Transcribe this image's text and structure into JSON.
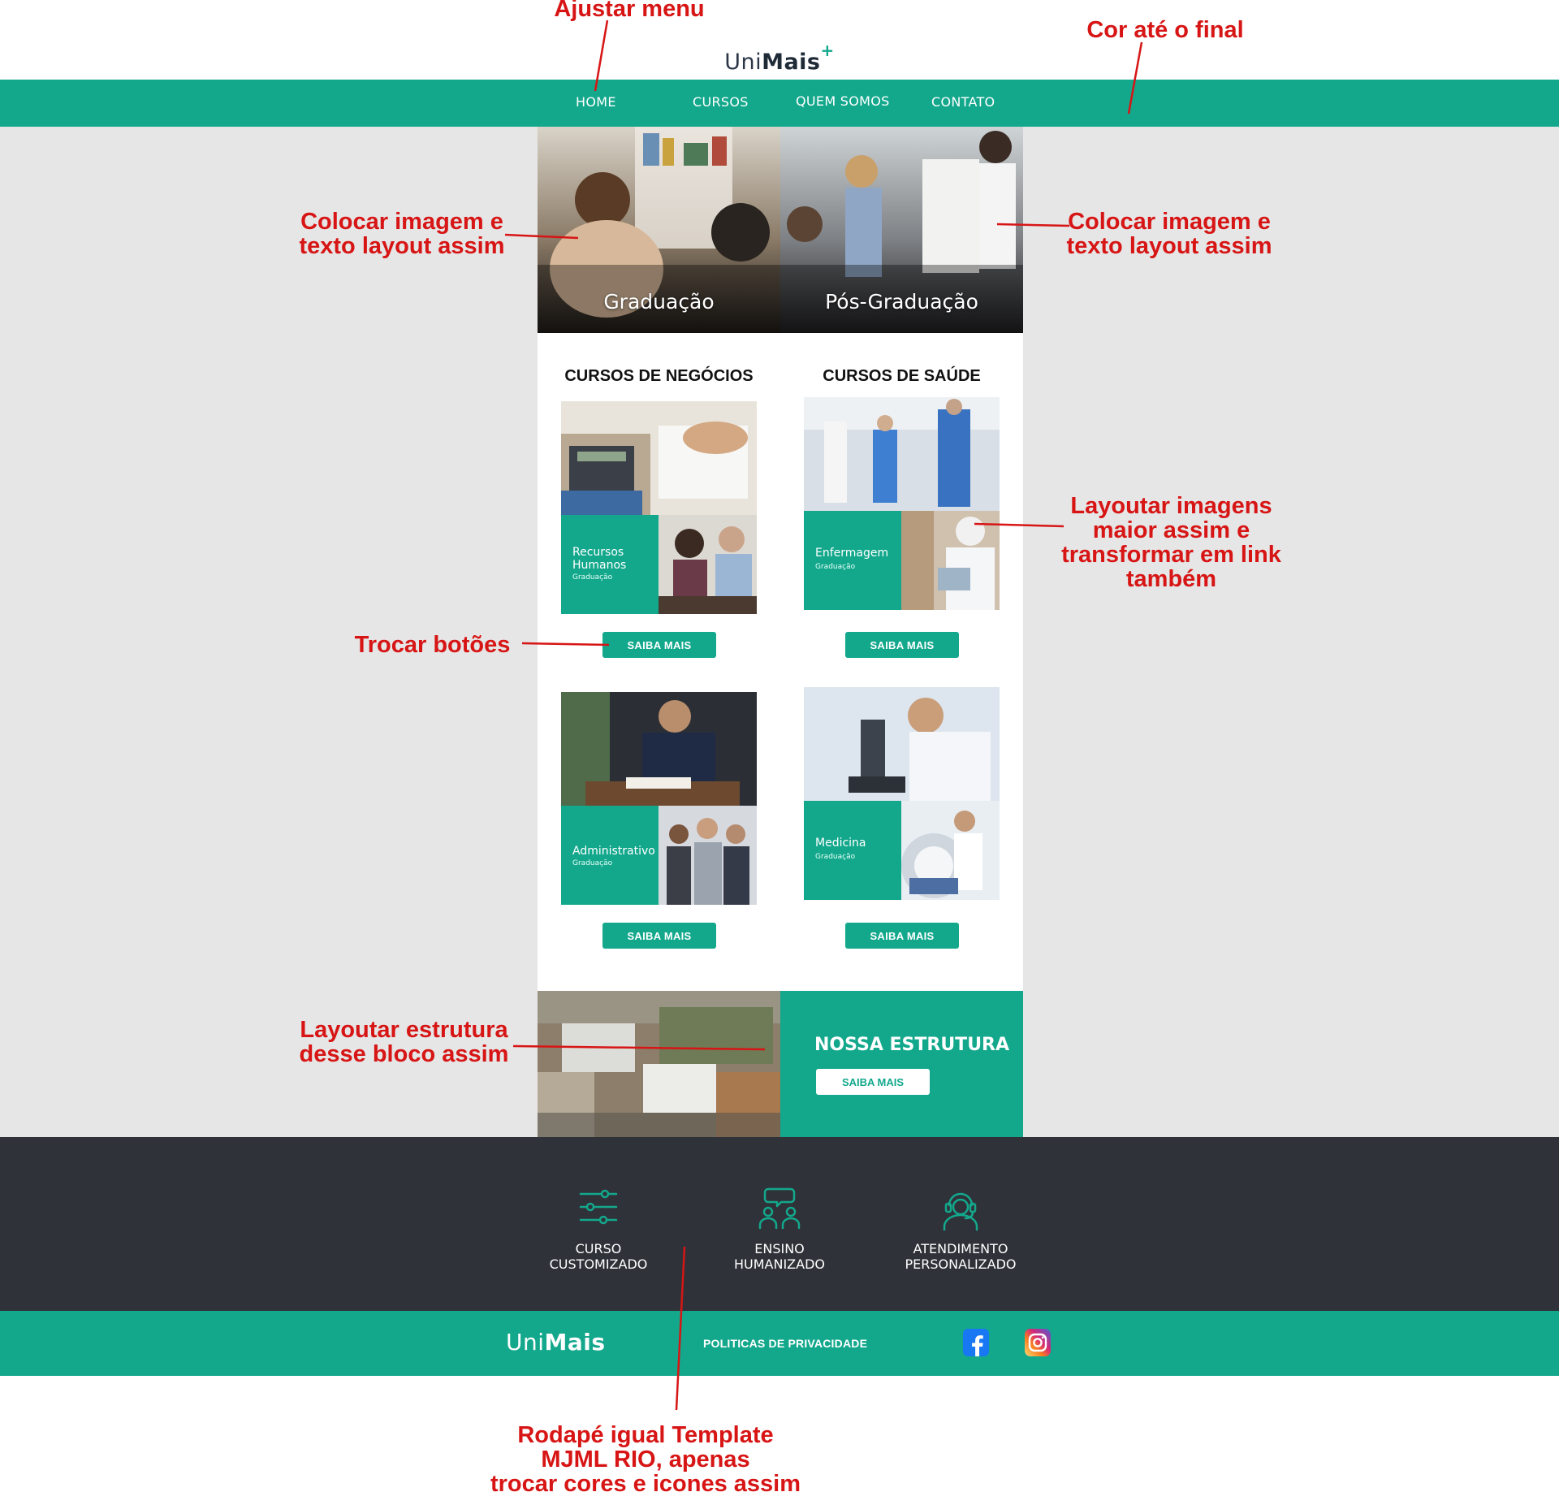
{
  "brand": {
    "logo_regular": "Uni",
    "logo_bold": "Mais",
    "logo_plus": "+",
    "primary_color": "#13a88c",
    "dark_color": "#2f3239",
    "annotation_color": "#d71515"
  },
  "nav": {
    "items": [
      "HOME",
      "CURSOS",
      "QUEM SOMOS",
      "CONTATO"
    ]
  },
  "hero": {
    "left_label": "Graduação",
    "right_label": "Pós-Graduação"
  },
  "sections": {
    "negocios_title": "CURSOS DE NEGÓCIOS",
    "saude_title": "CURSOS DE SAÚDE"
  },
  "cards": [
    {
      "title_line1": "Recursos",
      "title_line2": "Humanos",
      "subtitle": "Graduação",
      "button": "SAIBA MAIS"
    },
    {
      "title_line1": "Enfermagem",
      "title_line2": "",
      "subtitle": "Graduação",
      "button": "SAIBA MAIS"
    },
    {
      "title_line1": "Administrativo",
      "title_line2": "",
      "subtitle": "Graduação",
      "button": "SAIBA MAIS"
    },
    {
      "title_line1": "Medicina",
      "title_line2": "",
      "subtitle": "Graduação",
      "button": "SAIBA MAIS"
    }
  ],
  "estrutura": {
    "title": "NOSSA ESTRUTURA",
    "button": "SAIBA MAIS"
  },
  "features": [
    {
      "line1": "CURSO",
      "line2": "CUSTOMIZADO",
      "icon": "sliders-icon"
    },
    {
      "line1": "ENSINO",
      "line2": "HUMANIZADO",
      "icon": "people-chat-icon"
    },
    {
      "line1": "ATENDIMENTO",
      "line2": "PERSONALIZADO",
      "icon": "headset-agent-icon"
    }
  ],
  "footer": {
    "logo_regular": "Uni",
    "logo_bold": "Mais",
    "privacy": "POLITICAS DE PRIVACIDADE",
    "social": [
      "facebook-icon",
      "instagram-icon"
    ]
  },
  "annotations": {
    "menu": "Ajustar menu",
    "color": "Cor até  o  final",
    "hero_left_1": "Colocar imagem e",
    "hero_left_2": "texto layout assim",
    "hero_right_1": "Colocar imagem e",
    "hero_right_2": "texto layout assim",
    "images_1": "Layoutar imagens",
    "images_2": "maior assim e",
    "images_3": "transformar em  link",
    "images_4": "também",
    "buttons": "Trocar botões",
    "estrutura_1": "Layoutar estrutura",
    "estrutura_2": "desse bloco assim",
    "footer_1": "Rodapé igual Template",
    "footer_2": "MJML RIO, apenas",
    "footer_3": "trocar cores  e icones assim"
  }
}
